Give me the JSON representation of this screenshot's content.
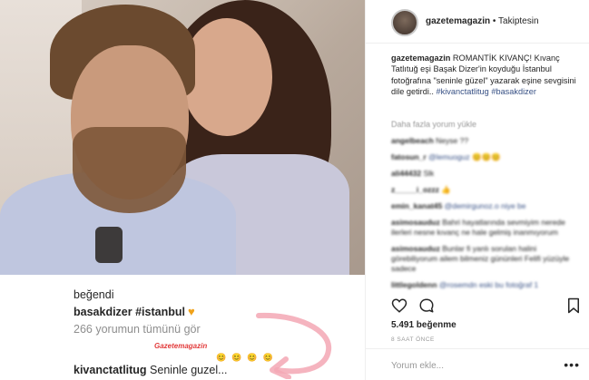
{
  "header": {
    "username": "gazetemagazin",
    "separator": " • ",
    "follow_status": "Takiptesin"
  },
  "caption": {
    "username": "gazetemagazin",
    "text": " ROMANTİK KIVANÇ! Kıvanç Tatlıtuğ eşi Başak Dizer'in koyduğu İstanbul fotoğrafına \"seninle güzel\" yazarak eşine sevgisini dile getirdi..",
    "hashtag1": "#kivanctatlitug",
    "hashtag2": "#basakdizer"
  },
  "more_comments": "Daha fazla yorum yükle",
  "comments": [
    {
      "user": "angelbeach",
      "text": " Neyse ??"
    },
    {
      "user": "fatosun_r",
      "text": " @lemuoguz 😊😊😊"
    },
    {
      "user": "ali44432",
      "text": " Slk"
    },
    {
      "user": "z_____i_ozzz",
      "text": " 👍"
    },
    {
      "user": "emin_kanat45",
      "text": " @demirgunoz.o niye be"
    },
    {
      "user": "asimosauduz",
      "text": " Bahri hayatlarında sevmiyim nerede ilerleri nesne kıvanç ne hale gelmiş inanmıyorum"
    },
    {
      "user": "asimosauduz",
      "text": " Bunlar fi yanlı sorulan halini görebiliyorum ailem bilmeniz gününleri Felifi yüzüyle sadece"
    },
    {
      "user": "littlegoldenn",
      "text": " @rosemdn eski bu fotoğraf 1"
    }
  ],
  "likes": "5.491 beğenme",
  "time_ago": "8 SAAT ÖNCE",
  "comment_placeholder": "Yorum ekle...",
  "more_dots": "•••",
  "photo_caption": {
    "liked": "beğendi",
    "user": "basakdizer",
    "tag": " #istanbul",
    "view_all": "266 yorumun tümünü gör",
    "stamp": "Gazetemagazin",
    "reply_user": "kivanctatlitug",
    "reply_text": " Seninle guzel..."
  },
  "colors": {
    "link": "#385185",
    "muted": "#8e8e8e",
    "heart": "#f0a21a",
    "highlight_arrow": "#f3a7b4"
  },
  "icons": [
    "heart-outline-icon",
    "comment-icon",
    "bookmark-icon",
    "heart-emoji-icon",
    "options-icon"
  ]
}
